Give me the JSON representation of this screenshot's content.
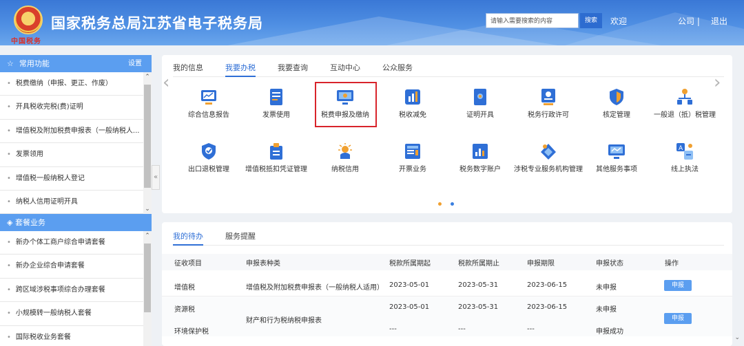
{
  "header": {
    "emblem_text": "中国税务",
    "title": "国家税务总局江苏省电子税务局",
    "search_placeholder": "请输入需要搜索的内容",
    "search_button": "搜索",
    "welcome": "欢迎",
    "company_suffix": "公司",
    "separator": "|",
    "logout": "退出"
  },
  "sidebar": {
    "common_title": "常用功能",
    "settings": "设置",
    "common_items": [
      "税费缴纳（申报、更正、作废）",
      "开具税收完税(费)证明",
      "增值税及附加税费申报表（一般纳税人...",
      "发票领用",
      "增值税一般纳税人登记",
      "纳税人信用证明开具"
    ],
    "package_title": "套餐业务",
    "package_items": [
      "新办个体工商户综合申请套餐",
      "新办企业综合申请套餐",
      "跨区域涉税事项综合办理套餐",
      "小规模转一般纳税人套餐",
      "国际税收业务套餐"
    ],
    "collapse_glyph": "«"
  },
  "main": {
    "tabs": [
      "我的信息",
      "我要办税",
      "我要查询",
      "互动中心",
      "公众服务"
    ],
    "active_tab": "我要办税",
    "services_row1": [
      {
        "label": "综合信息报告",
        "icon": "report-chart-icon"
      },
      {
        "label": "发票使用",
        "icon": "invoice-document-icon"
      },
      {
        "label": "税费申报及缴纳",
        "icon": "monitor-declare-icon"
      },
      {
        "label": "税收减免",
        "icon": "tax-relief-chart-icon"
      },
      {
        "label": "证明开具",
        "icon": "certificate-icon"
      },
      {
        "label": "税务行政许可",
        "icon": "administrative-license-icon"
      },
      {
        "label": "核定管理",
        "icon": "verify-shield-icon"
      },
      {
        "label": "一般退（抵）税管理",
        "icon": "refund-network-icon"
      }
    ],
    "services_row2": [
      {
        "label": "出口退税管理",
        "icon": "export-refund-shield-icon"
      },
      {
        "label": "增值税抵扣凭证管理",
        "icon": "vat-deduction-icon"
      },
      {
        "label": "纳税信用",
        "icon": "tax-credit-icon"
      },
      {
        "label": "开票业务",
        "icon": "invoicing-business-icon"
      },
      {
        "label": "税务数字账户",
        "icon": "digital-account-icon"
      },
      {
        "label": "涉税专业服务机构管理",
        "icon": "professional-service-icon"
      },
      {
        "label": "其他服务事项",
        "icon": "other-services-icon"
      },
      {
        "label": "线上执法",
        "icon": "online-law-enforcement-icon"
      }
    ],
    "carousel_pages": 2,
    "carousel_active": 1,
    "colors": {
      "accent": "#2f6fd6",
      "sidebar_header": "#5b9ef0",
      "highlight": "#d8232a",
      "dot_active": "#f0a030",
      "dot_inactive": "#3a7fe0"
    }
  },
  "todo": {
    "tabs": [
      "我的待办",
      "服务提醒"
    ],
    "active_tab": "我的待办",
    "columns": [
      "征收项目",
      "申报表种类",
      "税款所属期起",
      "税款所属期止",
      "申报期限",
      "申报状态",
      "操作"
    ],
    "rows": [
      {
        "item": "增值税",
        "form": "增值税及附加税费申报表（一般纳税人适用）",
        "start": "2023-05-01",
        "end": "2023-05-31",
        "deadline": "2023-06-15",
        "status": "未申报",
        "action": "申报"
      },
      {
        "item": "资源税",
        "form": "财产和行为税纳税申报表",
        "start": "2023-05-01",
        "end": "2023-05-31",
        "deadline": "2023-06-15",
        "status": "未申报",
        "action": "申报"
      },
      {
        "item": "环境保护税",
        "form": "",
        "start": "---",
        "end": "---",
        "deadline": "---",
        "status": "申报成功",
        "action": ""
      }
    ]
  }
}
